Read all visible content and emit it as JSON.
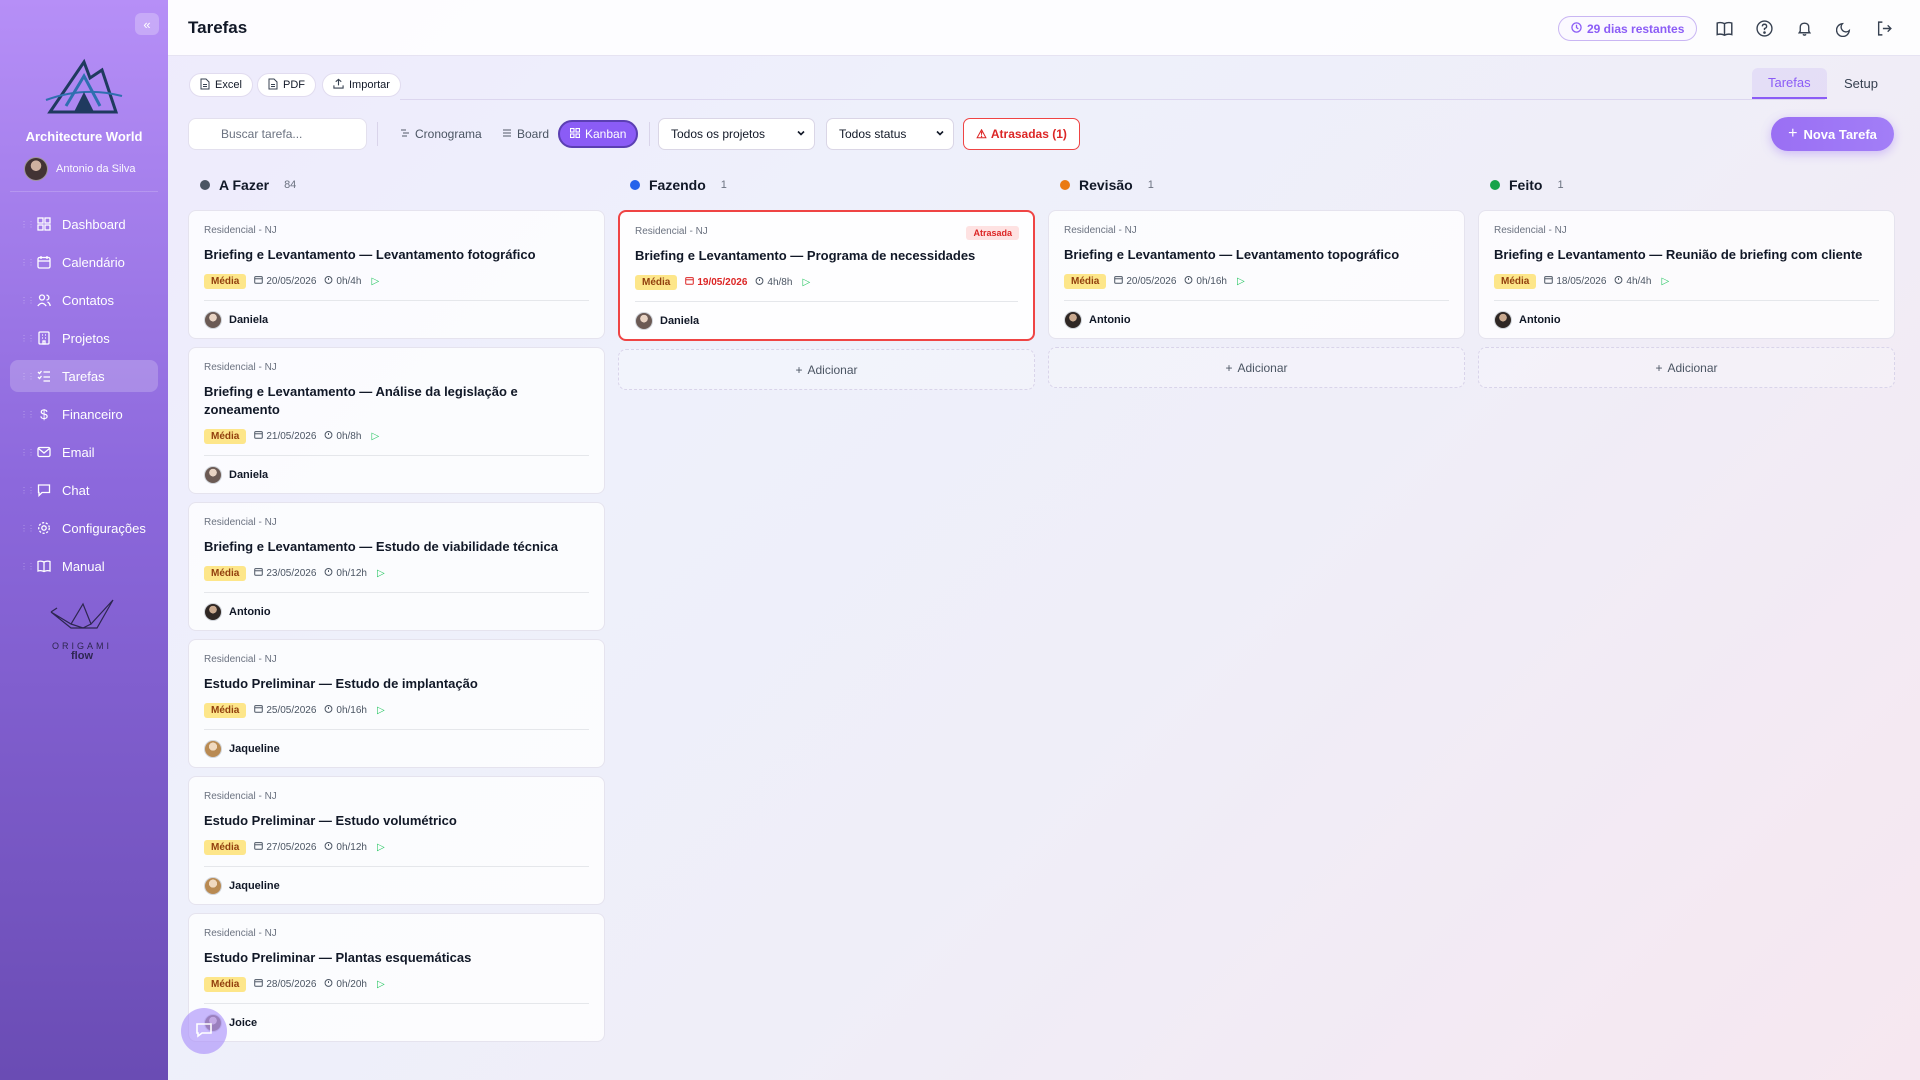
{
  "app": {
    "org_name": "Architecture World",
    "user_name": "Antonio da Silva",
    "brand_word": "ORIGAMI",
    "brand_flow": "flow",
    "accent": "#8b5cf6"
  },
  "sidebar": {
    "collapse_icon": "chevrons-left-icon",
    "items": [
      {
        "label": "Dashboard",
        "icon": "grid-icon"
      },
      {
        "label": "Calendário",
        "icon": "calendar-icon"
      },
      {
        "label": "Contatos",
        "icon": "users-icon"
      },
      {
        "label": "Projetos",
        "icon": "building-icon"
      },
      {
        "label": "Tarefas",
        "icon": "list-check-icon",
        "active": true
      },
      {
        "label": "Financeiro",
        "icon": "dollar-icon"
      },
      {
        "label": "Email",
        "icon": "mail-icon"
      },
      {
        "label": "Chat",
        "icon": "chat-icon"
      },
      {
        "label": "Configurações",
        "icon": "gear-icon"
      },
      {
        "label": "Manual",
        "icon": "book-icon"
      }
    ]
  },
  "header": {
    "title": "Tarefas",
    "trial_badge": "29 dias restantes"
  },
  "toolbar": {
    "export": {
      "excel": "Excel",
      "pdf": "PDF",
      "import": "Importar"
    },
    "tabs": {
      "tasks": "Tarefas",
      "setup": "Setup"
    },
    "search_placeholder": "Buscar tarefa...",
    "views": {
      "schedule": "Cronograma",
      "board": "Board",
      "kanban": "Kanban"
    },
    "project_filter": "Todos os projetos",
    "status_filter": "Todos status",
    "late_filter": "Atrasadas (1)",
    "new_task": "Nova Tarefa"
  },
  "kanban": {
    "add_label": "Adicionar",
    "late_tag": "Atrasada",
    "columns": [
      {
        "name": "A Fazer",
        "count": "84",
        "color": "#4b5563",
        "cards": [
          {
            "project": "Residencial - NJ",
            "title": "Briefing e Levantamento — Levantamento fotográfico",
            "priority": "Média",
            "date": "20/05/2026",
            "time": "0h/4h",
            "person": "Daniela"
          },
          {
            "project": "Residencial - NJ",
            "title": "Briefing e Levantamento — Análise da legislação e zoneamento",
            "priority": "Média",
            "date": "21/05/2026",
            "time": "0h/8h",
            "person": "Daniela"
          },
          {
            "project": "Residencial - NJ",
            "title": "Briefing e Levantamento — Estudo de viabilidade técnica",
            "priority": "Média",
            "date": "23/05/2026",
            "time": "0h/12h",
            "person": "Antonio"
          },
          {
            "project": "Residencial - NJ",
            "title": "Estudo Preliminar — Estudo de implantação",
            "priority": "Média",
            "date": "25/05/2026",
            "time": "0h/16h",
            "person": "Jaqueline"
          },
          {
            "project": "Residencial - NJ",
            "title": "Estudo Preliminar — Estudo volumétrico",
            "priority": "Média",
            "date": "27/05/2026",
            "time": "0h/12h",
            "person": "Jaqueline"
          },
          {
            "project": "Residencial - NJ",
            "title": "Estudo Preliminar — Plantas esquemáticas",
            "priority": "Média",
            "date": "28/05/2026",
            "time": "0h/20h",
            "person": "Joice"
          }
        ]
      },
      {
        "name": "Fazendo",
        "count": "1",
        "color": "#2563eb",
        "cards": [
          {
            "project": "Residencial - NJ",
            "title": "Briefing e Levantamento — Programa de necessidades",
            "priority": "Média",
            "date": "19/05/2026",
            "time": "4h/8h",
            "person": "Daniela",
            "overdue": true
          }
        ]
      },
      {
        "name": "Revisão",
        "count": "1",
        "color": "#ea7a12",
        "cards": [
          {
            "project": "Residencial - NJ",
            "title": "Briefing e Levantamento — Levantamento topográfico",
            "priority": "Média",
            "date": "20/05/2026",
            "time": "0h/16h",
            "person": "Antonio"
          }
        ]
      },
      {
        "name": "Feito",
        "count": "1",
        "color": "#16a34a",
        "cards": [
          {
            "project": "Residencial - NJ",
            "title": "Briefing e Levantamento — Reunião de briefing com cliente",
            "priority": "Média",
            "date": "18/05/2026",
            "time": "4h/4h",
            "person": "Antonio"
          }
        ]
      }
    ]
  }
}
